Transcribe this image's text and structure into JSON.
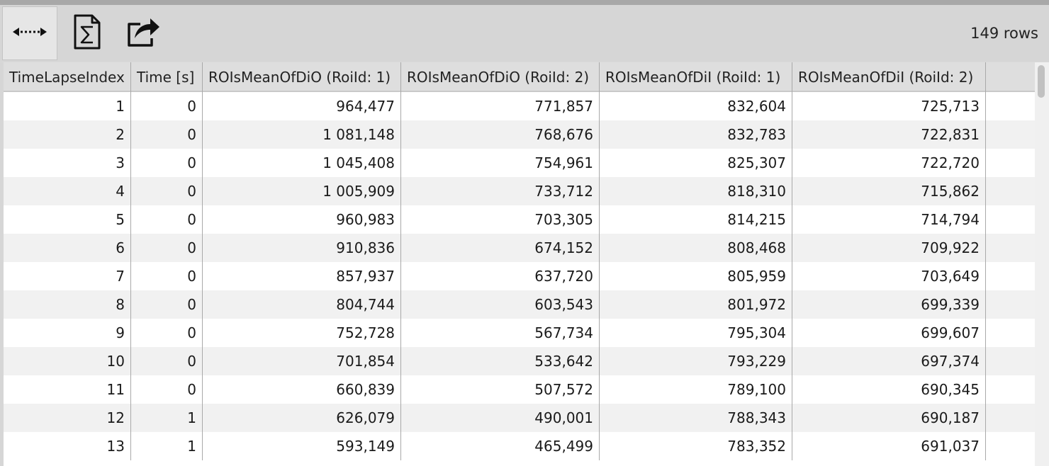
{
  "toolbar": {
    "buttons": [
      {
        "name": "expand-columns-button",
        "icon": "expand-horizontal-icon"
      },
      {
        "name": "statistics-button",
        "icon": "sum-document-icon"
      },
      {
        "name": "export-button",
        "icon": "share-export-icon"
      }
    ],
    "rows_count": "149 rows"
  },
  "table": {
    "columns": [
      "TimeLapseIndex",
      "Time [s]",
      "ROIsMeanOfDiO (RoiId: 1)",
      "ROIsMeanOfDiO (RoiId: 2)",
      "ROIsMeanOfDiI (RoiId: 1)",
      "ROIsMeanOfDiI (RoiId: 2)"
    ],
    "rows": [
      [
        "1",
        "0",
        "964,477",
        "771,857",
        "832,604",
        "725,713"
      ],
      [
        "2",
        "0",
        "1 081,148",
        "768,676",
        "832,783",
        "722,831"
      ],
      [
        "3",
        "0",
        "1 045,408",
        "754,961",
        "825,307",
        "722,720"
      ],
      [
        "4",
        "0",
        "1 005,909",
        "733,712",
        "818,310",
        "715,862"
      ],
      [
        "5",
        "0",
        "960,983",
        "703,305",
        "814,215",
        "714,794"
      ],
      [
        "6",
        "0",
        "910,836",
        "674,152",
        "808,468",
        "709,922"
      ],
      [
        "7",
        "0",
        "857,937",
        "637,720",
        "805,959",
        "703,649"
      ],
      [
        "8",
        "0",
        "804,744",
        "603,543",
        "801,972",
        "699,339"
      ],
      [
        "9",
        "0",
        "752,728",
        "567,734",
        "795,304",
        "699,607"
      ],
      [
        "10",
        "0",
        "701,854",
        "533,642",
        "793,229",
        "697,374"
      ],
      [
        "11",
        "0",
        "660,839",
        "507,572",
        "789,100",
        "690,345"
      ],
      [
        "12",
        "1",
        "626,079",
        "490,001",
        "788,343",
        "690,187"
      ],
      [
        "13",
        "1",
        "593,149",
        "465,499",
        "783,352",
        "691,037"
      ]
    ]
  }
}
